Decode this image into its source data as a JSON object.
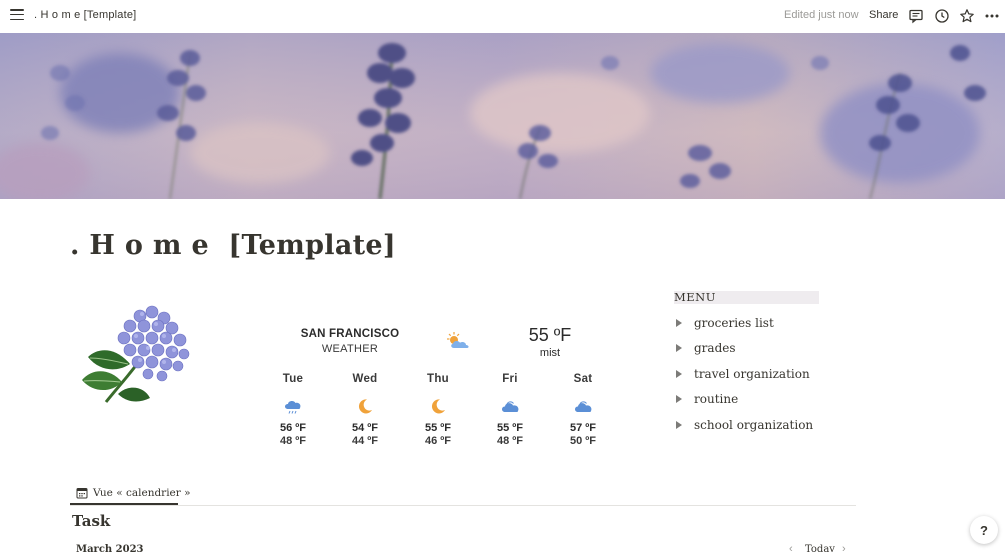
{
  "topbar": {
    "breadcrumb": ". H o m e  [Template]",
    "edited": "Edited just now",
    "share_label": "Share"
  },
  "page": {
    "title": ". H o m e  [Template]"
  },
  "weather": {
    "city": "SAN FRANCISCO",
    "subtitle": "WEATHER",
    "current_temp": "55 ºF",
    "current_condition": "mist",
    "current_icon": "partly-cloudy-icon",
    "days": [
      {
        "name": "Tue",
        "hi": "56 ºF",
        "lo": "48 ºF",
        "icon": "rain-cloud-icon"
      },
      {
        "name": "Wed",
        "hi": "54 ºF",
        "lo": "44 ºF",
        "icon": "moon-icon"
      },
      {
        "name": "Thu",
        "hi": "55 ºF",
        "lo": "46 ºF",
        "icon": "moon-icon"
      },
      {
        "name": "Fri",
        "hi": "55 ºF",
        "lo": "48 ºF",
        "icon": "cloud-icon"
      },
      {
        "name": "Sat",
        "hi": "57 ºF",
        "lo": "50 ºF",
        "icon": "cloud-icon"
      }
    ]
  },
  "menu": {
    "heading": "MENU",
    "items": [
      {
        "label": "groceries list"
      },
      {
        "label": "grades"
      },
      {
        "label": "travel organization"
      },
      {
        "label": "routine"
      },
      {
        "label": "school organization"
      }
    ]
  },
  "calendar": {
    "tab_label": "Vue « calendrier »",
    "section_title": "Task",
    "month": "March 2023",
    "today_label": "Today",
    "prev_glyph": "‹",
    "next_glyph": "›"
  },
  "help": {
    "label": "?"
  },
  "colors": {
    "text": "#37352f",
    "muted": "#9b9a97",
    "menu_highlight": "#efecef",
    "weather_blue": "#5b8fd6",
    "moon_orange": "#f0a23a"
  }
}
